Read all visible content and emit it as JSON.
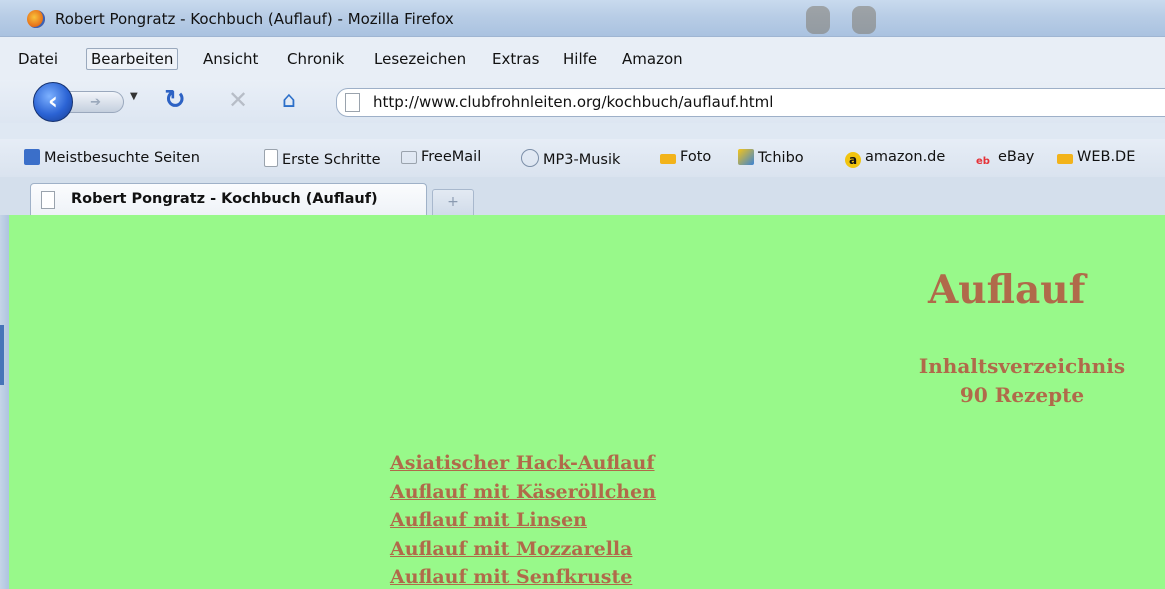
{
  "window": {
    "title": "Robert Pongratz - Kochbuch (Auflauf) - Mozilla Firefox"
  },
  "menu": {
    "items": [
      "Datei",
      "Bearbeiten",
      "Ansicht",
      "Chronik",
      "Lesezeichen",
      "Extras",
      "Hilfe",
      "Amazon"
    ]
  },
  "nav": {
    "url": "http://www.clubfrohnleiten.org/kochbuch/auflauf.html"
  },
  "bookmarks": [
    {
      "label": "Meistbesuchte Seiten",
      "icon": "search-icon",
      "color": "#3b6fc9"
    },
    {
      "label": "Erste Schritte",
      "icon": "page-icon",
      "color": "#ffffff"
    },
    {
      "label": "FreeMail",
      "icon": "mail-icon",
      "color": "#9aa3ad"
    },
    {
      "label": "MP3-Musik",
      "icon": "speaker-icon",
      "color": "#7c8fa8"
    },
    {
      "label": "Foto",
      "icon": "bank-icon",
      "color": "#f2b31a"
    },
    {
      "label": "Tchibo",
      "icon": "tchibo-icon",
      "color": "#e9a31e"
    },
    {
      "label": "amazon.de",
      "icon": "amazon-icon",
      "color": "#f1c40f"
    },
    {
      "label": "eBay",
      "icon": "ebay-icon",
      "color": "#e53238"
    },
    {
      "label": "WEB.DE",
      "icon": "bank-icon",
      "color": "#f2b31a"
    }
  ],
  "tab": {
    "label": "Robert Pongratz - Kochbuch (Auflauf)",
    "new_tab_symbol": "+"
  },
  "page": {
    "heading": "Auflauf",
    "subheading": "Inhaltsverzeichnis",
    "count": "90 Rezepte",
    "recipes": [
      "Asiatischer Hack-Auflauf",
      "Auflauf mit Käseröllchen",
      "Auflauf mit Linsen",
      "Auflauf mit Mozzarella",
      "Auflauf mit Senfkruste"
    ],
    "text_color": "#b06a4a",
    "background_color": "#98f98a"
  }
}
